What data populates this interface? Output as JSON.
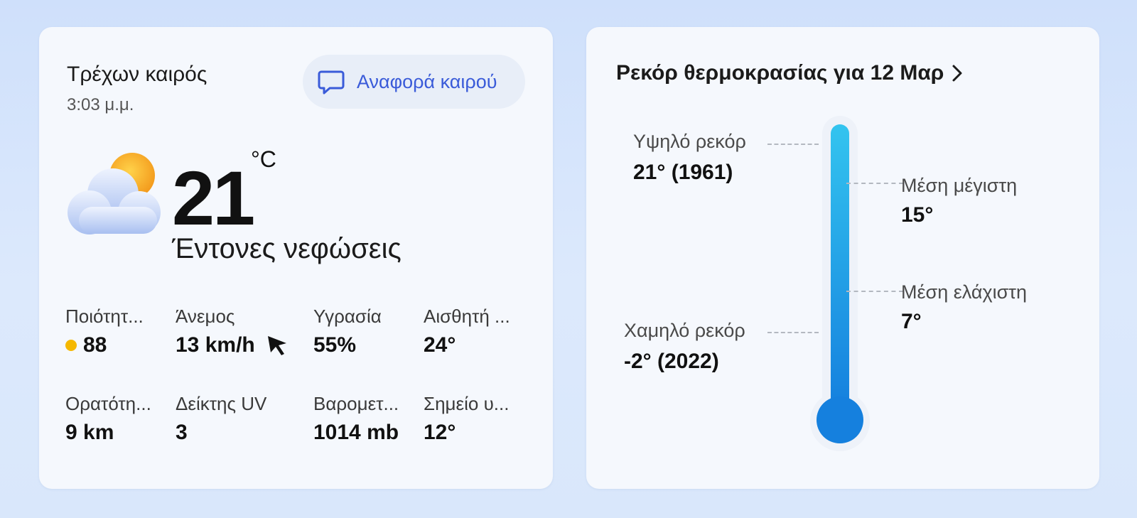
{
  "current": {
    "title": "Τρέχων καιρός",
    "time": "3:03 μ.μ.",
    "report_button_label": "Αναφορά καιρού",
    "temperature": "21",
    "unit": "°C",
    "condition": "Έντονες νεφώσεις",
    "stats": [
      {
        "label": "Ποιότητ...",
        "value": "88",
        "icon": "air-quality-dot-icon"
      },
      {
        "label": "Άνεμος",
        "value": "13 km/h",
        "icon": "wind-direction-arrow-icon"
      },
      {
        "label": "Υγρασία",
        "value": "55%"
      },
      {
        "label": "Αισθητή ...",
        "value": "24°"
      },
      {
        "label": "Ορατότη...",
        "value": "9 km"
      },
      {
        "label": "Δείκτης UV",
        "value": "3"
      },
      {
        "label": "Βαρομετ...",
        "value": "1014 mb"
      },
      {
        "label": "Σημείο υ...",
        "value": "12°"
      }
    ]
  },
  "records": {
    "title": "Ρεκόρ θερμοκρασίας για 12 Μαρ",
    "high_label": "Υψηλό ρεκόρ",
    "high_value": "21° (1961)",
    "avg_max_label": "Μέση μέγιστη",
    "avg_max_value": "15°",
    "avg_min_label": "Μέση ελάχιστη",
    "avg_min_value": "7°",
    "low_label": "Χαμηλό ρεκόρ",
    "low_value": "-2° (2022)"
  },
  "colors": {
    "accent": "#3a5bd9",
    "thermo_top": "#33c4ef",
    "thermo_bottom": "#1580de",
    "aqi_dot": "#f5b800"
  },
  "icons": {
    "report": "chat-bubble-icon",
    "weather": "cloud-sun-icon",
    "chevron": "chevron-right-icon"
  }
}
